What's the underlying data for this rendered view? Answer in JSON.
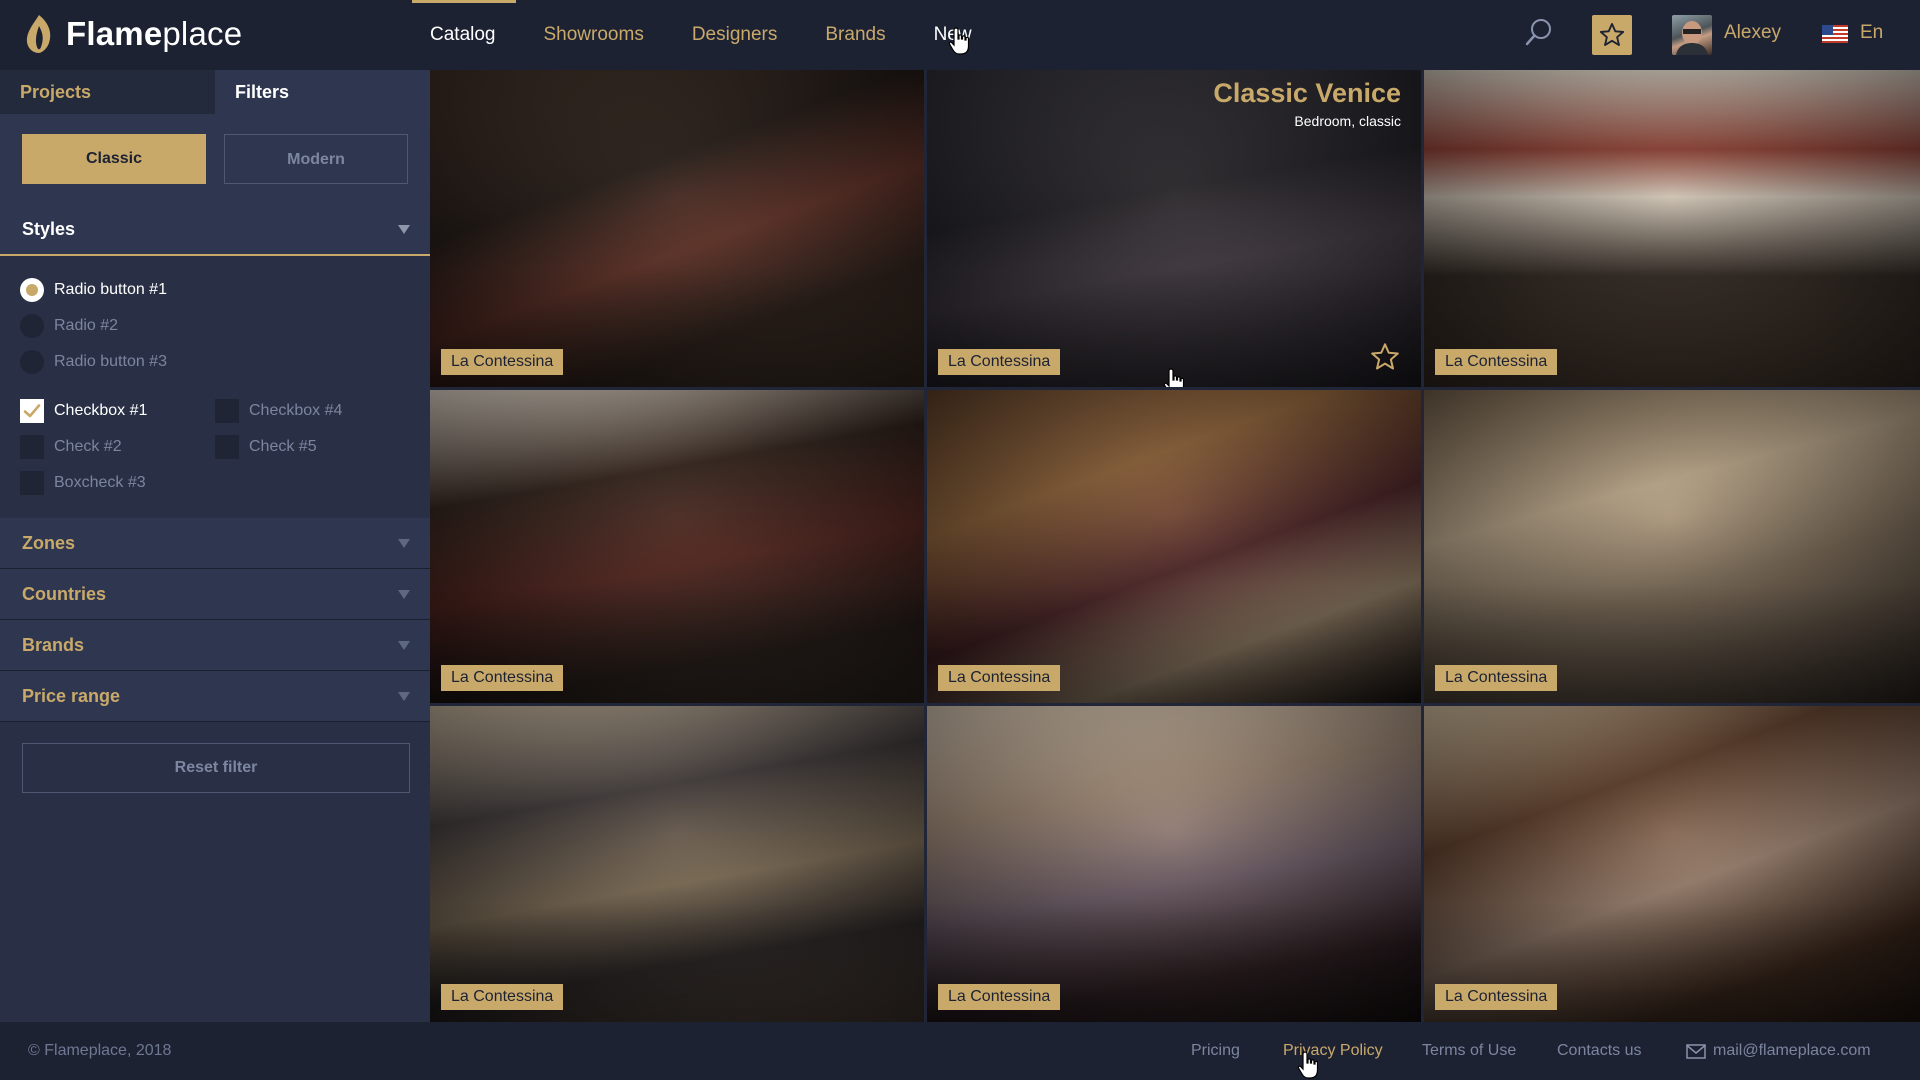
{
  "header": {
    "logo_bold": "Flame",
    "logo_light": "place",
    "nav": [
      "Catalog",
      "Showrooms",
      "Designers",
      "Brands",
      "New"
    ],
    "user_name": "Alexey",
    "language": "En"
  },
  "sidebar": {
    "tabs": [
      "Projects",
      "Filters"
    ],
    "toggle": [
      "Classic",
      "Modern"
    ],
    "styles": {
      "title": "Styles",
      "radios": [
        "Radio button #1",
        "Radio #2",
        "Radio button #3"
      ],
      "checks": [
        "Checkbox #1",
        "Check #2",
        "Boxcheck #3",
        "Checkbox #4",
        "Check #5"
      ]
    },
    "sections": [
      "Zones",
      "Countries",
      "Brands",
      "Price range"
    ],
    "reset": "Reset filter"
  },
  "feature": {
    "title": "Classic Venice",
    "subtitle": "Bedroom, classic"
  },
  "tiles": [
    "La Contessina",
    "La Contessina",
    "La Contessina",
    "La Contessina",
    "La Contessina",
    "La Contessina",
    "La Contessina",
    "La Contessina",
    "La Contessina"
  ],
  "footer": {
    "copyright": "© Flameplace, 2018",
    "links": [
      "Pricing",
      "Privacy Policy",
      "Terms of Use",
      "Contacts us"
    ],
    "email": "mail@flameplace.com"
  },
  "colors": {
    "accent": "#c9a96a",
    "background": "#202638",
    "panel": "#2f3750",
    "header": "#1d2233"
  }
}
